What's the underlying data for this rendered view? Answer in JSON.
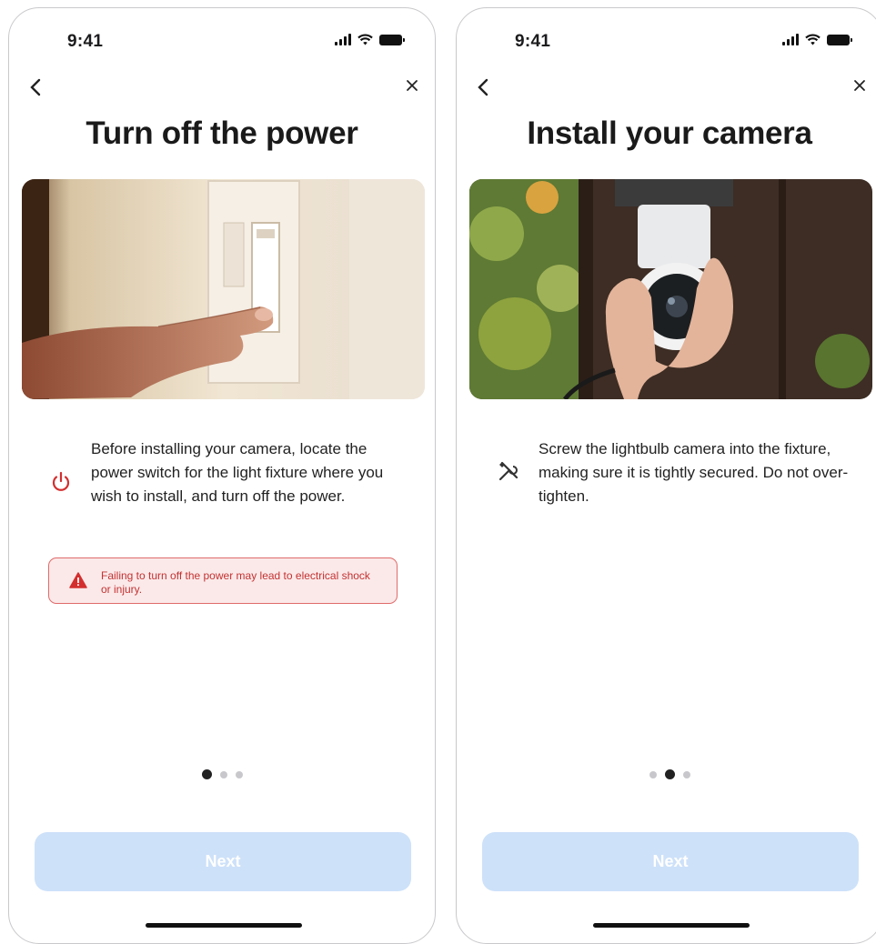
{
  "screens": [
    {
      "status_time": "9:41",
      "title": "Turn off the power",
      "icons": {
        "back": "chevron-left-icon",
        "close": "close-icon",
        "instruction": "power-icon",
        "warning": "warning-triangle-icon"
      },
      "hero_image": "hand pressing a light switch on a wall",
      "instruction": "Before installing your camera, locate the power switch for the light fixture where you wish to install, and turn off the power.",
      "warning": "Failing to turn off the power may lead to electrical shock or injury.",
      "pagination": {
        "total": 3,
        "active": 1
      },
      "next_label": "Next"
    },
    {
      "status_time": "9:41",
      "title": "Install your camera",
      "icons": {
        "back": "chevron-left-icon",
        "close": "close-icon",
        "instruction": "tools-icon"
      },
      "hero_image": "hand screwing a lightbulb camera into an outdoor fixture",
      "instruction": "Screw the lightbulb camera into the fixture, making sure it is tightly secured. Do not over-tighten.",
      "pagination": {
        "total": 3,
        "active": 2
      },
      "next_label": "Next"
    }
  ],
  "colors": {
    "accent_warning": "#d32f2f",
    "warning_bg": "#fbe9e9",
    "button_disabled": "#cde1f9",
    "text": "#1c1c1e"
  }
}
